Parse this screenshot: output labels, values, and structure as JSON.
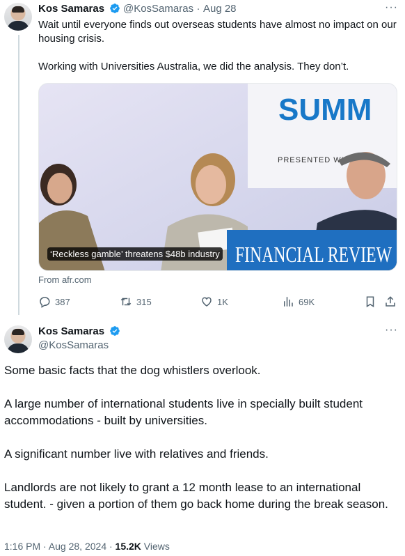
{
  "tweet1": {
    "author_name": "Kos Samaras",
    "handle": "@KosSamaras",
    "separator": "·",
    "date": "Aug 28",
    "paragraphs": [
      "Wait until everyone finds out overseas students have almost no impact on our housing crisis.",
      "Working with Universities Australia, we did the analysis. They don’t."
    ],
    "card": {
      "headline": "‘Reckless gamble’ threatens $48b industry",
      "banner_text": "SUMM",
      "presented_text": "PRESENTED WIT",
      "masthead": "FINANCIAL REVIEW",
      "source": "From afr.com"
    },
    "actions": {
      "replies": "387",
      "reposts": "315",
      "likes": "1K",
      "views": "69K"
    }
  },
  "tweet2": {
    "author_name": "Kos Samaras",
    "handle": "@KosSamaras",
    "paragraphs": [
      "Some basic facts that the dog whistlers overlook.",
      "A large number of international students live in specially built student accommodations - built by universities.",
      "A significant number live with relatives and friends.",
      "Landlords are not likely to grant a 12 month lease to an international student. - given a portion of them go back home during the break season."
    ],
    "time": "1:16 PM · Aug 28, 2024 · ",
    "views_count": "15.2K",
    "views_label": "Views"
  },
  "colors": {
    "verified": "#1d9bf0",
    "secondary_text": "#536471",
    "primary_text": "#0f1419",
    "banner_blue": "#1878c8"
  },
  "icons": [
    "verified-badge-icon",
    "more-icon",
    "reply-icon",
    "repost-icon",
    "like-icon",
    "views-icon",
    "bookmark-icon",
    "share-icon"
  ]
}
